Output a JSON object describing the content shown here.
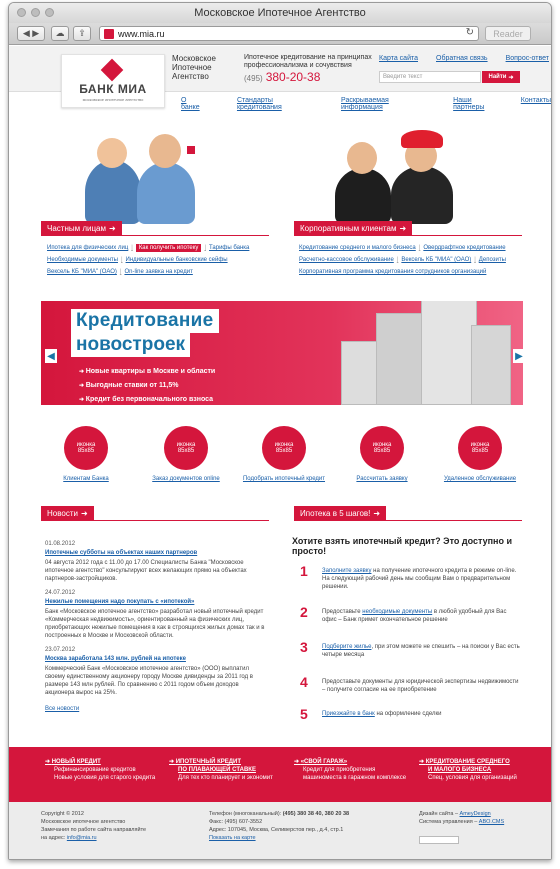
{
  "browser": {
    "title": "Московское Ипотечное Агентство",
    "url": "www.mia.ru",
    "reader": "Reader"
  },
  "header": {
    "logo_name": "БАНК МИА",
    "logo_sub": "московское ипотечное агентство",
    "agency": [
      "Московское",
      "Ипотечное",
      "Агентство"
    ],
    "tagline": "Ипотечное кредитование на принципах профессионализма и сочувствия",
    "phone_code": "(495)",
    "phone": "380-20-38",
    "top_links": [
      "Карта сайта",
      "Обратная связь",
      "Вопрос-ответ"
    ],
    "search_placeholder": "Введите текст",
    "search_button": "Найти"
  },
  "nav": [
    "О банке",
    "Стандарты кредитования",
    "Раскрываемая информация",
    "Наши партнеры",
    "Контакты"
  ],
  "private": {
    "title": "Частным лицам",
    "links": [
      "Ипотека для физических лиц",
      "Как получить ипотеку",
      "Тарифы банка",
      "Необходимые документы",
      "Индивидуальные банковские сейфы",
      "Вексель КБ \"МИА\" (ОАО)",
      "On-line заявка на кредит"
    ]
  },
  "corporate": {
    "title": "Корпоративным клиентам",
    "links": [
      "Кредитование среднего и малого бизнеса",
      "Овердрафтное кредитование",
      "Расчетно-кассовое обслуживание",
      "Вексель КБ \"МИА\" (ОАО)",
      "Депозиты",
      "Корпоративная программа кредитования сотрудников организаций"
    ]
  },
  "banner": {
    "title1": "Кредитование",
    "title2": "новостроек",
    "bullets": [
      "Новые квартиры в Москве и области",
      "Выгодные ставки от 11,5%",
      "Кредит без первоначального взноса"
    ]
  },
  "icons": [
    {
      "ph": "иконка",
      "size": "85x85",
      "label": "Клиентам Банка"
    },
    {
      "ph": "иконка",
      "size": "85x85",
      "label": "Заказ документов online"
    },
    {
      "ph": "иконка",
      "size": "85x85",
      "label": "Подобрать ипотечный кредит"
    },
    {
      "ph": "иконка",
      "size": "85x85",
      "label": "Рассчитать заявку"
    },
    {
      "ph": "иконка",
      "size": "85x85",
      "label": "Удаленное обслуживание"
    }
  ],
  "news": {
    "title": "Новости",
    "items": [
      {
        "date": "01.08.2012",
        "title": "Ипотечные субботы на объектах наших партнеров",
        "text": "04 августа 2012 года с 11.00 до 17.00 Специалисты Банка \"Московское ипотечное агентство\" консультируют всех желающих прямо на объектах партнеров-застройщиков."
      },
      {
        "date": "24.07.2012",
        "title": "Нежилые помещения надо покупать с «ипотекой»",
        "text": "Банк «Московское ипотечное агентство» разработал новый ипотечный кредит «Коммерческая недвижимость», ориентированный на физических лиц, приобретающих нежилые помещения в как в строящихся жилых домах так и в построенных в Москве и Московской области."
      },
      {
        "date": "23.07.2012",
        "title": "Москва заработала 143 млн. рублей на ипотеке",
        "text": "Коммерческий Банк «Московское ипотечное агентство» (ООО) выплатил своему единственному акционеру городу Москве дивиденды за 2011 год в размере 143 млн рублей. По сравнению с 2011 годом объем доходов акционера вырос на 25%."
      }
    ],
    "all": "Все новости"
  },
  "mortgage": {
    "title": "Ипотека в 5 шагов!",
    "question": "Хотите взять ипотечный кредит? Это доступно и просто!",
    "steps": [
      {
        "n": "1",
        "link": "Заполните заявку",
        "text": " на получение ипотечного кредита в режиме on-line. На следующий рабочий день мы сообщим Вам о предварительном решении."
      },
      {
        "n": "2",
        "pre": "Предоставьте ",
        "link": "необходимые документы",
        "text": " в любой удобный для Вас офис – Банк примет окончательное решение"
      },
      {
        "n": "3",
        "link": "Подберите жилье",
        "text": ", при этом можете не спешить – на поиски у Вас есть четыре месяца"
      },
      {
        "n": "4",
        "text": "Предоставьте документы для юридической экспертизы недвижимости – получите согласие на ее приобретение"
      },
      {
        "n": "5",
        "link": "Приезжайте в банк",
        "text": " на оформление сделки"
      }
    ]
  },
  "promo": [
    {
      "h1": "НОВЫЙ КРЕДИТ",
      "t1": "Рефинансирование кредитов",
      "t2": "Новые условия для старого кредита"
    },
    {
      "h1": "ИПОТЕЧНЫЙ КРЕДИТ",
      "h2": "ПО ПЛАВАЮЩЕЙ СТАВКЕ",
      "t1": "Для тех кто планирует и экономит"
    },
    {
      "h1": "«СВОЙ ГАРАЖ»",
      "t1": "Кредит для приобретения",
      "t2": "машиноместа в гаражном комплексе"
    },
    {
      "h1": "КРЕДИТОВАНИЕ СРЕДНЕГО",
      "h2": "И МАЛОГО БИЗНЕСА",
      "t1": "Спец. условия для организаций"
    }
  ],
  "footer": {
    "copy": "Copyright © 2012",
    "org": "Московское ипотечное агентство",
    "rem": "Замечания по работе сайта направляйте",
    "mail_pre": "на адрес: ",
    "mail": "info@mia.ru",
    "tel_lbl": "Телефон (многоканальный): ",
    "tel": "(495) 380 38 40, 380 20 38",
    "fax": "Факс: (495) 607-3552",
    "addr": "Адрес: 107045, Москва, Селиверстов пер., д.4, стр.1",
    "map": "Показать на карте",
    "design_pre": "Дизайн сайта – ",
    "design": "AmeyDesign",
    "cms_pre": "Система управления – ",
    "cms": "ABO.CMS"
  }
}
